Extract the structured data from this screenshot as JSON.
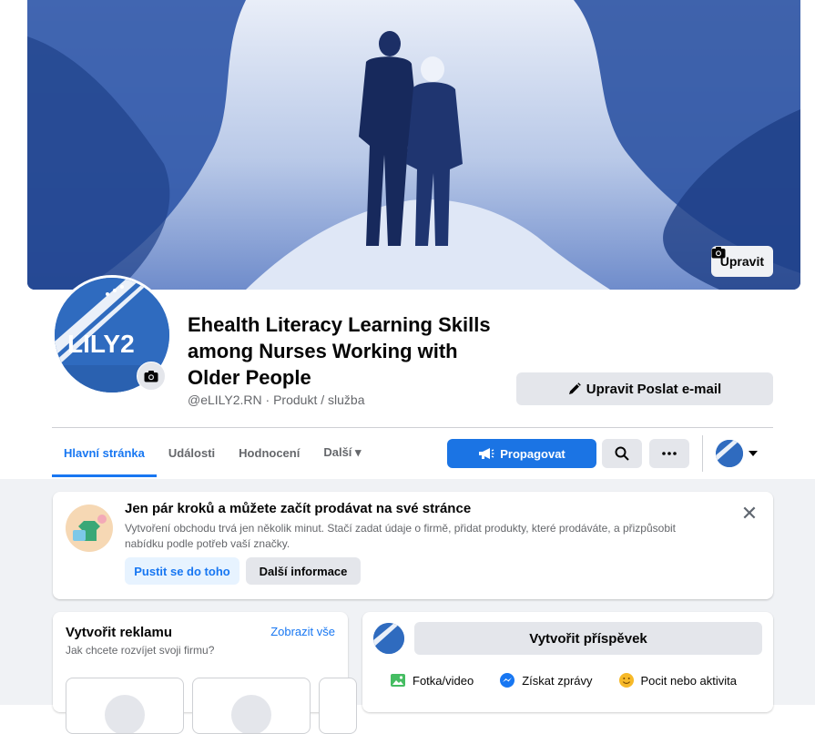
{
  "cover": {
    "edit_label": "Upravit"
  },
  "profile": {
    "title": "Ehealth Literacy Learning Skills among Nurses Working with Older People",
    "subtitle": "@eLILY2.RN · Produkt / služba",
    "edit_email_label": "Upravit Poslat e-mail",
    "logo_text": "LILY2"
  },
  "tabs": [
    {
      "label": "Hlavní stránka",
      "active": true
    },
    {
      "label": "Události"
    },
    {
      "label": "Hodnocení"
    },
    {
      "label": "Další ▾"
    }
  ],
  "actions": {
    "promote_label": "Propagovat"
  },
  "shop_banner": {
    "title": "Jen pár kroků a můžete začít prodávat na své stránce",
    "description": "Vytvoření obchodu trvá jen několik minut. Stačí zadat údaje o firmě, přidat produkty, které prodáváte, a přizpůsobit nabídku podle potřeb vaší značky.",
    "start_label": "Pustit se do toho",
    "more_label": "Další informace",
    "close_glyph": "✕"
  },
  "ad_panel": {
    "title": "Vytvořit reklamu",
    "subtitle": "Jak chcete rozvíjet svoji firmu?",
    "link": "Zobrazit vše"
  },
  "composer": {
    "create_label": "Vytvořit příspěvek",
    "actions": [
      {
        "label": "Fotka/video",
        "icon": "photo-icon"
      },
      {
        "label": "Získat zprávy",
        "icon": "messenger-icon"
      },
      {
        "label": "Pocit nebo aktivita",
        "icon": "smiley-icon"
      }
    ]
  },
  "colors": {
    "accent": "#1877f2",
    "promote": "#1b74e4",
    "feed_bg": "#f0f2f5"
  }
}
